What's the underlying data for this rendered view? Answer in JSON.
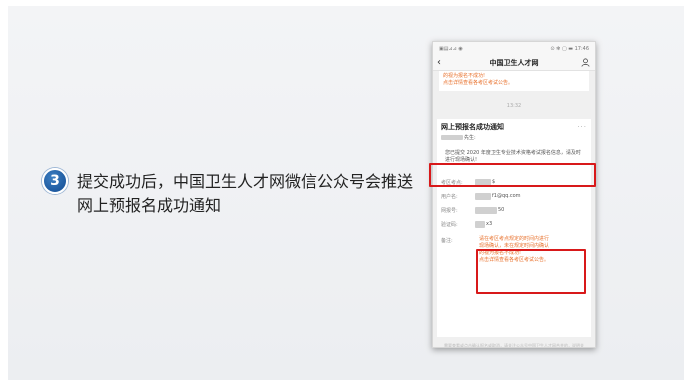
{
  "step": {
    "number": "3",
    "text": "提交成功后，中国卫生人才网微信公众号会推送网上预报名成功通知"
  },
  "phone": {
    "status_left": "▣▤⊿⊿ ◉",
    "status_right": "⊙ ✻ ▢ ▬ 17:46",
    "nav_title": "中国卫生人才网",
    "nav_back_glyph": "‹",
    "prev_message_lines": [
      "的视为报名不成功!",
      "点击详情查看各考区考试公告。"
    ],
    "timestamp": "13:32",
    "card": {
      "title": "网上预报名成功通知",
      "more": "···",
      "greeting_suffix": "先生:",
      "body": "您已提交 2020 年度卫生专业技术资格考试报名信息，请及时进行现场确认!",
      "rows": [
        {
          "key": "考区考点:",
          "value_suffix": "$"
        },
        {
          "key": "用户名:",
          "value_suffix": "f1@qq.com"
        },
        {
          "key": "网报号:",
          "value_suffix": "50"
        },
        {
          "key": "验证码:",
          "value_suffix": "x3"
        }
      ],
      "remark_key": "备注:",
      "remark_lines": [
        "请在考区考点规定的时间内进行",
        "现场确认，未在规定时间内确认",
        "的视为报名不成功!",
        "点击详情查看各考区考试公告。"
      ],
      "footer_note": "需要查看或点击确认报名或取消，请关注公众号中国卫生人才网合并的，说明关注确认此类信息。"
    }
  },
  "colors": {
    "accent_blue": "#1e5aa0",
    "highlight_red": "#d8191a",
    "notice_orange": "#e8712c"
  },
  "icons": {
    "nav_user": "user-icon",
    "nav_back": "back-arrow-icon"
  }
}
